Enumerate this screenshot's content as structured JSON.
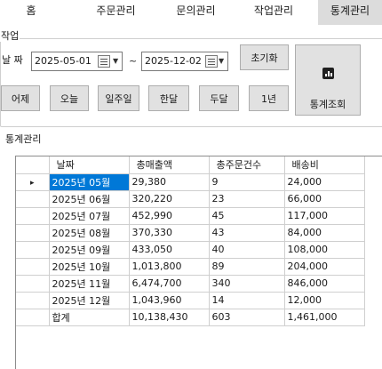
{
  "nav": {
    "tabs": [
      {
        "label": "홈",
        "active": false
      },
      {
        "label": "주문관리",
        "active": false
      },
      {
        "label": "문의관리",
        "active": false
      },
      {
        "label": "작업관리",
        "active": false
      },
      {
        "label": "통계관리",
        "active": true
      }
    ]
  },
  "work": {
    "group_title": "작업",
    "date_label": "날 짜",
    "start_date": "2025-05-01",
    "separator": "~",
    "end_date": "2025-12-02",
    "reset_label": "초기화",
    "range_buttons": [
      "어제",
      "오늘",
      "일주일",
      "한달",
      "두달",
      "1년"
    ],
    "query_label": "통계조회",
    "query_icon": "bar-chart-icon"
  },
  "stats": {
    "panel_title": "통계관리",
    "columns": [
      "날짜",
      "총매출액",
      "총주문건수",
      "배송비"
    ],
    "rows": [
      [
        "2025년 05월",
        "29,380",
        "9",
        "24,000"
      ],
      [
        "2025년 06월",
        "320,220",
        "23",
        "66,000"
      ],
      [
        "2025년 07월",
        "452,990",
        "45",
        "117,000"
      ],
      [
        "2025년 08월",
        "370,330",
        "43",
        "84,000"
      ],
      [
        "2025년 09월",
        "433,050",
        "40",
        "108,000"
      ],
      [
        "2025년 10월",
        "1,013,800",
        "89",
        "204,000"
      ],
      [
        "2025년 11월",
        "6,474,700",
        "340",
        "846,000"
      ],
      [
        "2025년 12월",
        "1,043,960",
        "14",
        "12,000"
      ],
      [
        "합계",
        "10,138,430",
        "603",
        "1,461,000"
      ]
    ],
    "current_row_marker": "▸",
    "selection_color": "#0078d7"
  }
}
